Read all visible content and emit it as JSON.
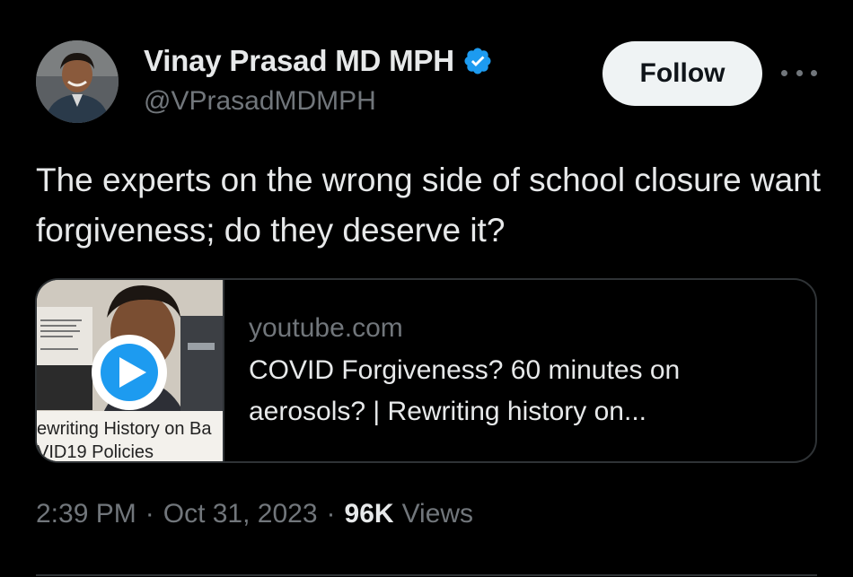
{
  "author": {
    "display_name": "Vinay Prasad MD MPH",
    "handle": "@VPrasadMDMPH",
    "verified": true,
    "avatar_icon": "user-avatar"
  },
  "actions": {
    "follow_label": "Follow",
    "more_icon": "more-horizontal-icon"
  },
  "tweet": {
    "text": "The experts on the wrong side of school closure want forgiveness; do they deserve it?"
  },
  "link_card": {
    "domain": "youtube.com",
    "title": "COVID Forgiveness? 60 minutes on aerosols? | Rewriting history on...",
    "thumbnail_caption_line1": "ewriting History on Ba",
    "thumbnail_caption_line2": "VID19 Policies",
    "play_icon": "play-icon"
  },
  "meta": {
    "time": "2:39 PM",
    "date": "Oct 31, 2023",
    "views_count": "96K",
    "views_label": "Views",
    "separator": "·"
  },
  "colors": {
    "background": "#000000",
    "primary_text": "#e7e9ea",
    "secondary_text": "#71767b",
    "border": "#2f3336",
    "verified_blue": "#1d9bf0",
    "follow_bg": "#eff3f4"
  }
}
